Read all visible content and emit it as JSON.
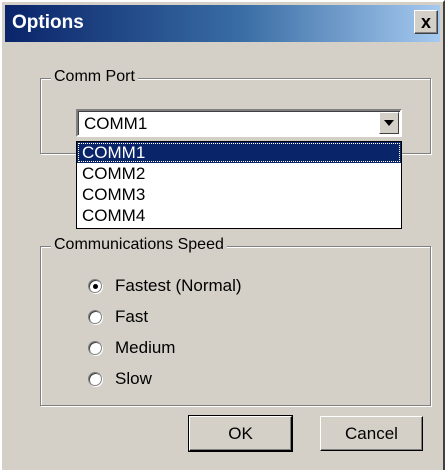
{
  "window": {
    "title": "Options",
    "close_label": "x"
  },
  "comm_port": {
    "legend": "Comm Port",
    "selected": "COMM1",
    "options": [
      "COMM1",
      "COMM2",
      "COMM3",
      "COMM4"
    ]
  },
  "speed": {
    "legend": "Communications Speed",
    "selected": "Fastest (Normal)",
    "options": [
      "Fastest (Normal)",
      "Fast",
      "Medium",
      "Slow"
    ]
  },
  "buttons": {
    "ok": "OK",
    "cancel": "Cancel"
  },
  "colors": {
    "title_bar_start": "#0a246a",
    "title_bar_end": "#a6caf0",
    "dialog_face": "#d4d0c8",
    "selection": "#0a246a"
  }
}
